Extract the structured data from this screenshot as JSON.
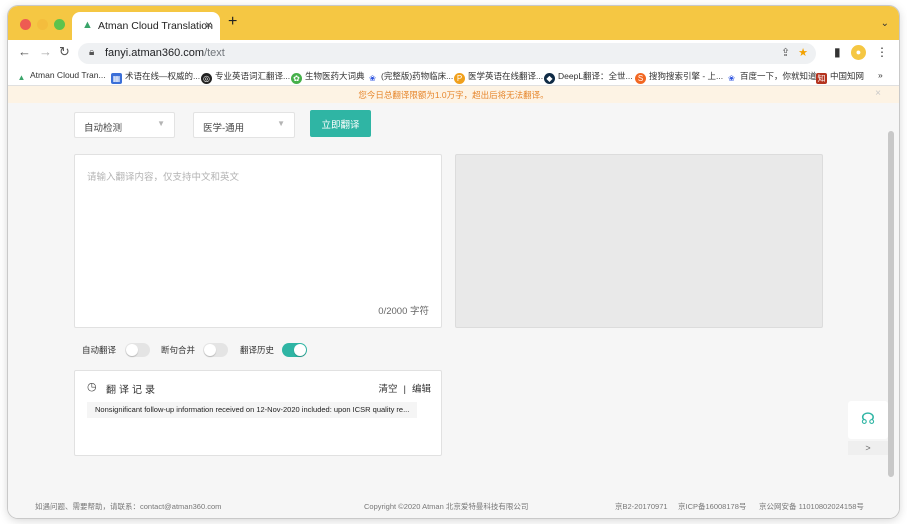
{
  "browser": {
    "tab_title": "Atman Cloud Translation",
    "tab_close": "×",
    "new_tab": "+",
    "url_host": "fanyi.atman360.com",
    "url_path": "/text",
    "bookmarks": [
      {
        "label": "Atman Cloud Tran...",
        "icon": "atman-icon",
        "color": "#3aa46a"
      },
      {
        "label": "术语在线—权威的...",
        "icon": "term-online-icon",
        "color": "#3b6fd8"
      },
      {
        "label": "专业英语词汇翻译...",
        "icon": "globe-icon",
        "color": "#222222"
      },
      {
        "label": "生物医药大词典",
        "icon": "biomed-dict-icon",
        "color": "#45b04a"
      },
      {
        "label": "(完整版)药物临床...",
        "icon": "baidu-paw-icon",
        "color": "#2c52e0"
      },
      {
        "label": "医学英语在线翻译...",
        "icon": "medical-translate-icon",
        "color": "#f0a01c"
      },
      {
        "label": "DeepL翻译：全世...",
        "icon": "deepl-icon",
        "color": "#0f2b46"
      },
      {
        "label": "搜狗搜索引擎 - 上...",
        "icon": "sogou-icon",
        "color": "#f26722"
      },
      {
        "label": "百度一下，你就知道",
        "icon": "baidu-paw-icon",
        "color": "#2c52e0"
      },
      {
        "label": "中国知网",
        "icon": "cnki-icon",
        "color": "#b5331f"
      }
    ],
    "bookmarks_more": "»"
  },
  "notice": {
    "text": "您今日总翻译限额为1.0万字，超出后将无法翻译。",
    "close": "×"
  },
  "controls": {
    "source_lang": "自动检测",
    "domain": "医学-通用",
    "translate_button": "立即翻译"
  },
  "editor": {
    "placeholder": "请输入翻译内容，仅支持中文和英文",
    "char_count": "0/2000 字符"
  },
  "toggles": [
    {
      "label": "自动翻译",
      "on": false
    },
    {
      "label": "断句合并",
      "on": false
    },
    {
      "label": "翻译历史",
      "on": true
    }
  ],
  "history": {
    "title": "翻译记录",
    "clear": "清空",
    "separator": "|",
    "edit": "编辑",
    "items": [
      "Nonsignificant follow-up information received on 12-Nov-2020 included: upon ICSR quality re..."
    ]
  },
  "side_widget": {
    "arrow": ">"
  },
  "footer": {
    "contact": "如遇问题、需要帮助，请联系：contact@atman360.com",
    "copyright": "Copyright ©2020 Atman   北京爱特曼科技有限公司",
    "license1": "京B2-20170971",
    "license2": "京ICP备16008178号",
    "license3": "京公网安备 11010802024158号"
  },
  "colors": {
    "accent": "#2fb5a4",
    "notice_text": "#e6862c",
    "tab_bar": "#f5c743"
  }
}
